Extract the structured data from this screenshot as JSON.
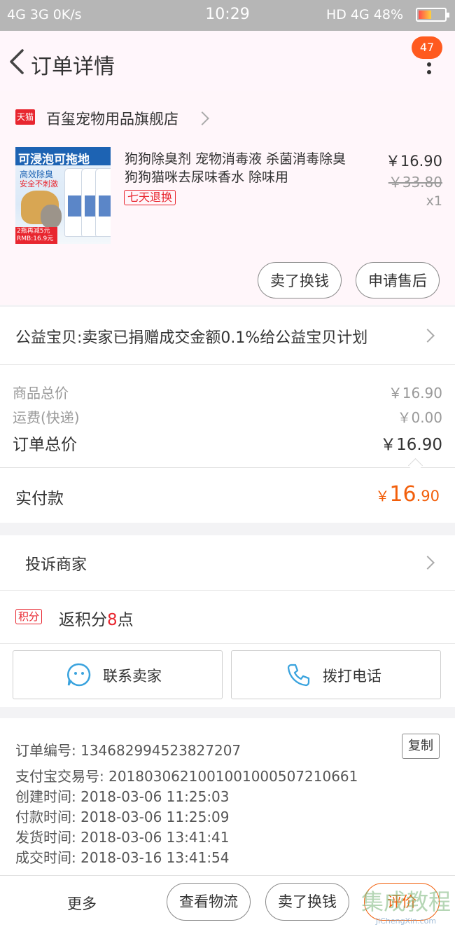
{
  "status_bar": {
    "left": "4G 3G 0K/s",
    "time": "10:29",
    "right": "HD 4G 48%"
  },
  "header": {
    "title": "订单详情",
    "badge": "47"
  },
  "shop": {
    "platform_tag": "天猫",
    "name": "百玺宠物用品旗舰店"
  },
  "product": {
    "image_text": {
      "headline": "可浸泡可拖地",
      "line1": "高效除臭",
      "line2": "安全不刺激",
      "promo": "2瓶再减5元 RMB:16.9元"
    },
    "name": "狗狗除臭剂 宠物消毒液 杀菌消毒除臭狗狗猫咪去尿味香水 除味用",
    "return_tag": "七天退换",
    "price": "￥16.90",
    "original_price": "￥33.80",
    "quantity": "x1",
    "actions": [
      "卖了换钱",
      "申请售后"
    ]
  },
  "charity": {
    "text": "公益宝贝:卖家已捐赠成交金额0.1%给公益宝贝计划"
  },
  "totals": {
    "goods_label": "商品总价",
    "goods_value": "￥16.90",
    "shipping_label": "运费(快递)",
    "shipping_value": "￥0.00",
    "order_label": "订单总价",
    "order_value": "￥16.90"
  },
  "paid": {
    "label": "实付款",
    "currency": "￥",
    "integer": "16",
    "decimal": ".90"
  },
  "complaint": {
    "label": "投诉商家"
  },
  "points": {
    "tag": "积分",
    "prefix": "返积分",
    "count": "8",
    "suffix": "点"
  },
  "contact": {
    "seller": "联系卖家",
    "phone": "拨打电话"
  },
  "info": {
    "order_no": "订单编号: 134682994523827207",
    "alipay_no": "支付宝交易号: 2018030621001001000507210661",
    "created": "创建时间: 2018-03-06 11:25:03",
    "paid": "付款时间: 2018-03-06 11:25:09",
    "shipped": "发货时间: 2018-03-06 13:41:41",
    "closed": "成交时间: 2018-03-16 13:41:54",
    "copy_label": "复制"
  },
  "bottom_bar": {
    "more": "更多",
    "logistics": "查看物流",
    "resell": "卖了换钱",
    "review": "评价"
  },
  "watermark": {
    "text": "集成教程",
    "url": "JiChengXin.com"
  },
  "colors": {
    "accent_orange": "#f25f0b",
    "tmall_red": "#e8262f",
    "contact_blue": "#3aa3de",
    "header_bg": "#fff6fb"
  }
}
